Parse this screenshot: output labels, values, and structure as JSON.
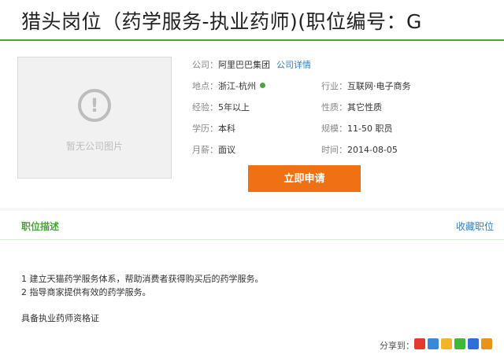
{
  "page": {
    "title": "猎头岗位（药学服务-执业药师)(职位编号：G"
  },
  "company_logo": {
    "placeholder": "暂无公司图片",
    "icon": "exclamation-circle-icon"
  },
  "info": {
    "company_label": "公司：",
    "company_value": "阿里巴巴集团",
    "company_link": "公司详情",
    "location_label": "地点：",
    "location_value": "浙江-杭州",
    "industry_label": "行业：",
    "industry_value": "互联网·电子商务",
    "experience_label": "经验：",
    "experience_value": "5年以上",
    "nature_label": "性质：",
    "nature_value": "其它性质",
    "education_label": "学历：",
    "education_value": "本科",
    "scale_label": "规模：",
    "scale_value": "11-50 职员",
    "salary_label": "月薪：",
    "salary_value": "面议",
    "time_label": "时间：",
    "time_value": "2014-08-05"
  },
  "apply_button": "立即申请",
  "section": {
    "title": "职位描述",
    "favorite": "收藏职位"
  },
  "description": {
    "line1": "1 建立天猫药学服务体系，帮助消费者获得购买后的药学服务。",
    "line2": "2 指导商家提供有效的药学服务。",
    "line3": "具备执业药师资格证"
  },
  "share": {
    "label": "分享到：",
    "icons": [
      "weibo-icon",
      "qzone-icon",
      "tencent-weibo-icon",
      "wechat-icon",
      "renren-icon",
      "douban-icon"
    ],
    "colors": [
      "#e43c2c",
      "#3a89d8",
      "#f2b52a",
      "#3fb837",
      "#2f6fd8",
      "#e8941a"
    ]
  }
}
